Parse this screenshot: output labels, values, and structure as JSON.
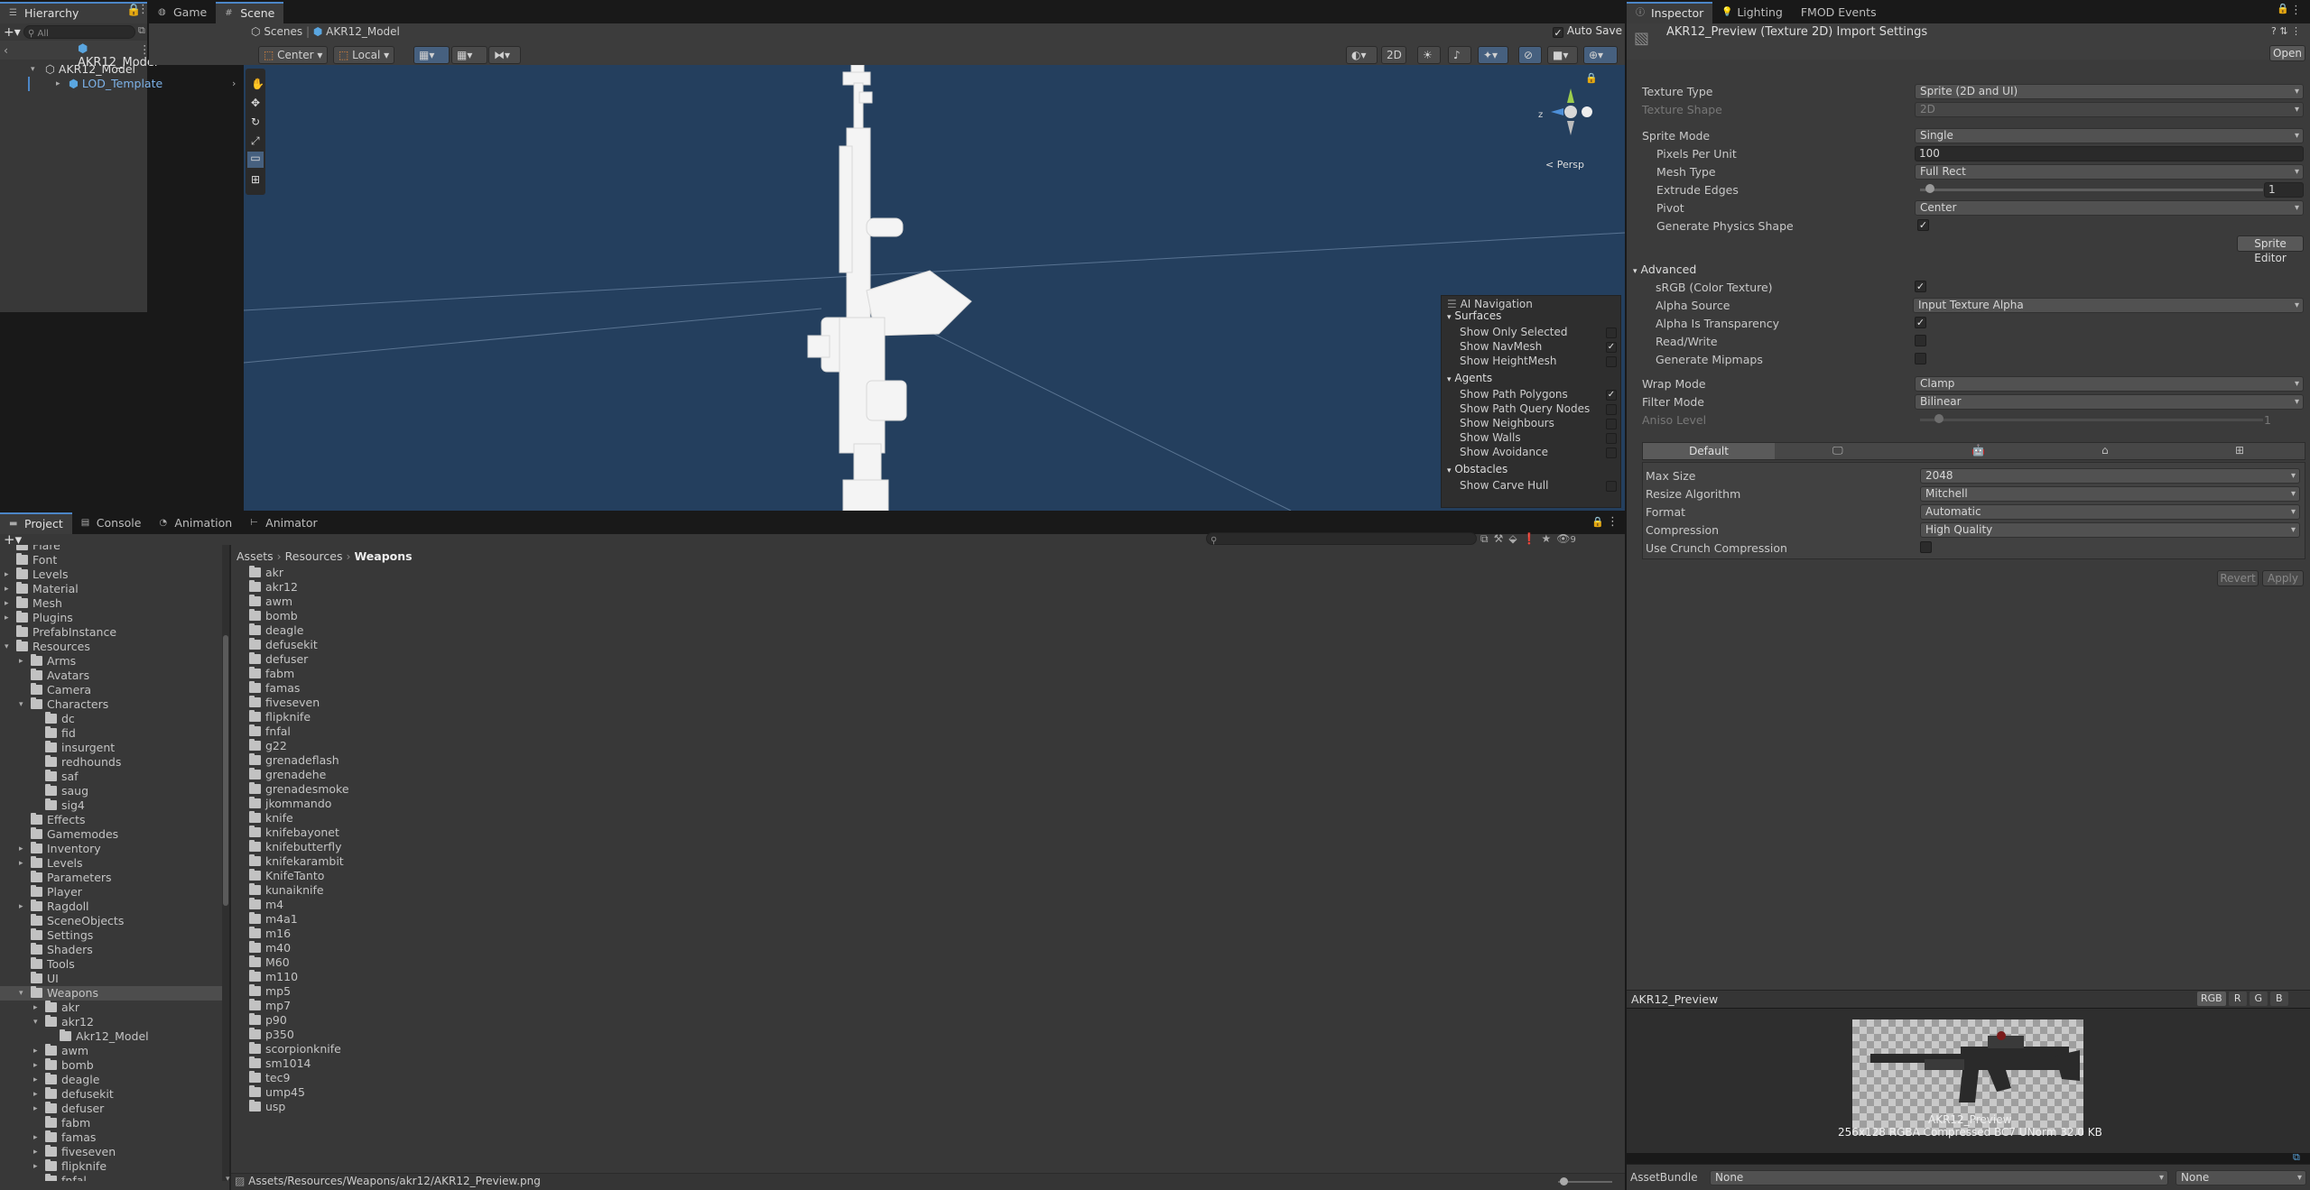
{
  "hierarchy": {
    "tab": "Hierarchy",
    "search_placeholder": "All",
    "scene_name": "AKR12_Model",
    "items": [
      "AKR12_Model",
      "LOD_Template"
    ]
  },
  "scene_view": {
    "tabs": [
      "Game",
      "Scene"
    ],
    "breadcrumb_root": "Scenes",
    "breadcrumb_current": "AKR12_Model",
    "auto_save": "Auto Save",
    "pivot_mode": "Center",
    "pivot_rotation": "Local",
    "btn_2d": "2D",
    "persp_label": "Persp",
    "gizmo_axis": "z"
  },
  "ai_navigation": {
    "title": "AI Navigation",
    "sections": [
      {
        "label": "Surfaces",
        "items": [
          {
            "label": "Show Only Selected",
            "checked": false
          },
          {
            "label": "Show NavMesh",
            "checked": true
          },
          {
            "label": "Show HeightMesh",
            "checked": false
          }
        ]
      },
      {
        "label": "Agents",
        "items": [
          {
            "label": "Show Path Polygons",
            "checked": true
          },
          {
            "label": "Show Path Query Nodes",
            "checked": false
          },
          {
            "label": "Show Neighbours",
            "checked": false
          },
          {
            "label": "Show Walls",
            "checked": false
          },
          {
            "label": "Show Avoidance",
            "checked": false
          }
        ]
      },
      {
        "label": "Obstacles",
        "items": [
          {
            "label": "Show Carve Hull",
            "checked": false
          }
        ]
      }
    ]
  },
  "project": {
    "tabs": [
      "Project",
      "Console",
      "Animation",
      "Animator"
    ],
    "breadcrumb": [
      "Assets",
      "Resources",
      "Weapons"
    ],
    "hidden_count": "9",
    "status_path": "Assets/Resources/Weapons/akr12/AKR12_Preview.png",
    "tree": [
      {
        "label": "Flare",
        "depth": 0,
        "arrow": ""
      },
      {
        "label": "Font",
        "depth": 0,
        "arrow": ""
      },
      {
        "label": "Levels",
        "depth": 0,
        "arrow": "▸"
      },
      {
        "label": "Material",
        "depth": 0,
        "arrow": "▸"
      },
      {
        "label": "Mesh",
        "depth": 0,
        "arrow": "▸"
      },
      {
        "label": "Plugins",
        "depth": 0,
        "arrow": "▸"
      },
      {
        "label": "PrefabInstance",
        "depth": 0,
        "arrow": ""
      },
      {
        "label": "Resources",
        "depth": 0,
        "arrow": "▾"
      },
      {
        "label": "Arms",
        "depth": 1,
        "arrow": "▸"
      },
      {
        "label": "Avatars",
        "depth": 1,
        "arrow": ""
      },
      {
        "label": "Camera",
        "depth": 1,
        "arrow": ""
      },
      {
        "label": "Characters",
        "depth": 1,
        "arrow": "▾"
      },
      {
        "label": "dc",
        "depth": 2,
        "arrow": ""
      },
      {
        "label": "fid",
        "depth": 2,
        "arrow": ""
      },
      {
        "label": "insurgent",
        "depth": 2,
        "arrow": ""
      },
      {
        "label": "redhounds",
        "depth": 2,
        "arrow": ""
      },
      {
        "label": "saf",
        "depth": 2,
        "arrow": ""
      },
      {
        "label": "saug",
        "depth": 2,
        "arrow": ""
      },
      {
        "label": "sig4",
        "depth": 2,
        "arrow": ""
      },
      {
        "label": "Effects",
        "depth": 1,
        "arrow": ""
      },
      {
        "label": "Gamemodes",
        "depth": 1,
        "arrow": ""
      },
      {
        "label": "Inventory",
        "depth": 1,
        "arrow": "▸"
      },
      {
        "label": "Levels",
        "depth": 1,
        "arrow": "▸"
      },
      {
        "label": "Parameters",
        "depth": 1,
        "arrow": ""
      },
      {
        "label": "Player",
        "depth": 1,
        "arrow": ""
      },
      {
        "label": "Ragdoll",
        "depth": 1,
        "arrow": "▸"
      },
      {
        "label": "SceneObjects",
        "depth": 1,
        "arrow": ""
      },
      {
        "label": "Settings",
        "depth": 1,
        "arrow": ""
      },
      {
        "label": "Shaders",
        "depth": 1,
        "arrow": ""
      },
      {
        "label": "Tools",
        "depth": 1,
        "arrow": ""
      },
      {
        "label": "UI",
        "depth": 1,
        "arrow": ""
      },
      {
        "label": "Weapons",
        "depth": 1,
        "arrow": "▾",
        "selected": true
      },
      {
        "label": "akr",
        "depth": 2,
        "arrow": "▸"
      },
      {
        "label": "akr12",
        "depth": 2,
        "arrow": "▾"
      },
      {
        "label": "Akr12_Model",
        "depth": 3,
        "arrow": ""
      },
      {
        "label": "awm",
        "depth": 2,
        "arrow": "▸"
      },
      {
        "label": "bomb",
        "depth": 2,
        "arrow": "▸"
      },
      {
        "label": "deagle",
        "depth": 2,
        "arrow": "▸"
      },
      {
        "label": "defusekit",
        "depth": 2,
        "arrow": "▸"
      },
      {
        "label": "defuser",
        "depth": 2,
        "arrow": "▸"
      },
      {
        "label": "fabm",
        "depth": 2,
        "arrow": ""
      },
      {
        "label": "famas",
        "depth": 2,
        "arrow": "▸"
      },
      {
        "label": "fiveseven",
        "depth": 2,
        "arrow": "▸"
      },
      {
        "label": "flipknife",
        "depth": 2,
        "arrow": "▸"
      },
      {
        "label": "fnfal",
        "depth": 2,
        "arrow": ""
      }
    ],
    "folders": [
      "akr",
      "akr12",
      "awm",
      "bomb",
      "deagle",
      "defusekit",
      "defuser",
      "fabm",
      "famas",
      "fiveseven",
      "flipknife",
      "fnfal",
      "g22",
      "grenadeflash",
      "grenadehe",
      "grenadesmoke",
      "jkommando",
      "knife",
      "knifebayonet",
      "knifebutterfly",
      "knifekarambit",
      "KnifeTanto",
      "kunaiknife",
      "m4",
      "m4a1",
      "m16",
      "m40",
      "M60",
      "m110",
      "mp5",
      "mp7",
      "p90",
      "p350",
      "scorpionknife",
      "sm1014",
      "tec9",
      "ump45",
      "usp"
    ]
  },
  "inspector": {
    "tabs": [
      "Inspector",
      "Lighting",
      "FMOD Events"
    ],
    "title": "AKR12_Preview (Texture 2D) Import Settings",
    "open_button": "Open",
    "fields": {
      "texture_type_label": "Texture Type",
      "texture_type": "Sprite (2D and UI)",
      "texture_shape_label": "Texture Shape",
      "texture_shape": "2D",
      "sprite_mode_label": "Sprite Mode",
      "sprite_mode": "Single",
      "ppu_label": "Pixels Per Unit",
      "ppu": "100",
      "mesh_type_label": "Mesh Type",
      "mesh_type": "Full Rect",
      "extrude_label": "Extrude Edges",
      "extrude": "1",
      "pivot_label": "Pivot",
      "pivot": "Center",
      "physics_label": "Generate Physics Shape",
      "sprite_editor": "Sprite Editor",
      "advanced_label": "Advanced",
      "srgb_label": "sRGB (Color Texture)",
      "alpha_source_label": "Alpha Source",
      "alpha_source": "Input Texture Alpha",
      "alpha_transp_label": "Alpha Is Transparency",
      "readwrite_label": "Read/Write",
      "mipmaps_label": "Generate Mipmaps",
      "wrap_label": "Wrap Mode",
      "wrap": "Clamp",
      "filter_label": "Filter Mode",
      "filter": "Bilinear",
      "aniso_label": "Aniso Level",
      "aniso": "1",
      "platform_default": "Default",
      "max_size_label": "Max Size",
      "max_size": "2048",
      "resize_label": "Resize Algorithm",
      "resize": "Mitchell",
      "format_label": "Format",
      "format": "Automatic",
      "compression_label": "Compression",
      "compression": "High Quality",
      "crunch_label": "Use Crunch Compression",
      "revert": "Revert",
      "apply": "Apply"
    },
    "checks": {
      "physics": true,
      "srgb": true,
      "alpha_transp": true,
      "readwrite": false,
      "mipmaps": false,
      "crunch": false
    },
    "preview": {
      "title": "AKR12_Preview",
      "channels": [
        "RGB",
        "R",
        "G",
        "B"
      ],
      "name": "AKR12_Preview",
      "info": "256x128  RGBA Compressed BC7 UNorm   32.0 KB"
    },
    "assetbundle_label": "AssetBundle",
    "assetbundle_value": "None",
    "assetbundle_variant": "None"
  }
}
